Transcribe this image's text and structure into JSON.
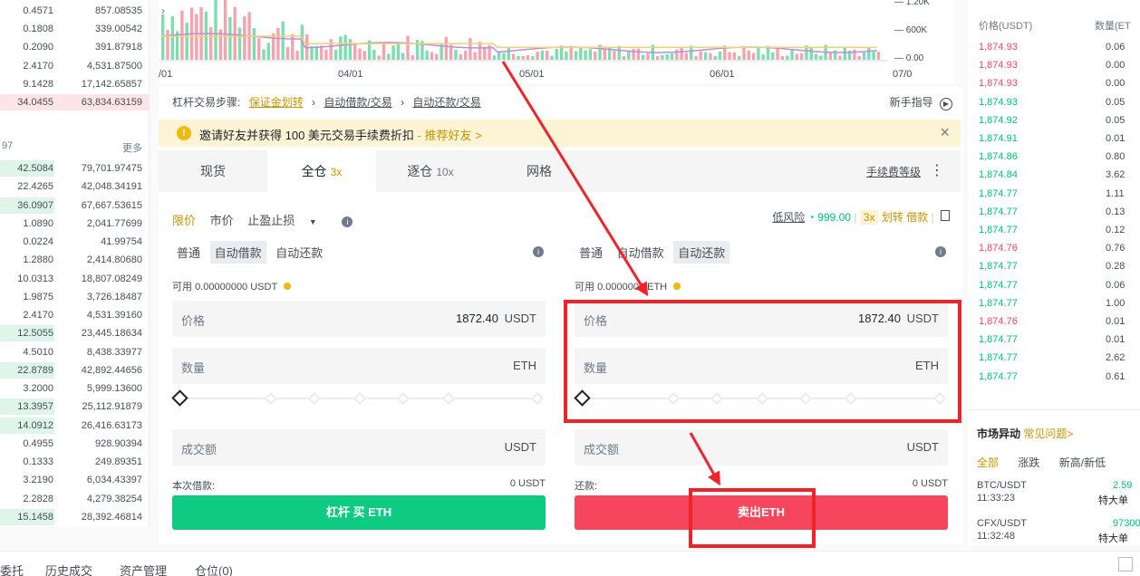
{
  "left_book": {
    "top_rows": [
      {
        "a": "0.4571",
        "b": "857.08535"
      },
      {
        "a": "0.1808",
        "b": "339.00542"
      },
      {
        "a": "0.2090",
        "b": "391.87918"
      },
      {
        "a": "2.4170",
        "b": "4,531.87500"
      },
      {
        "a": "9.1428",
        "b": "17,142.65857"
      },
      {
        "a": "34.0455",
        "b": "63,834.63159"
      }
    ],
    "mid_left": "97",
    "more": "更多",
    "bottom_rows": [
      {
        "a": "42.5084",
        "b": "79,701.97475"
      },
      {
        "a": "22.4265",
        "b": "42,048.34191"
      },
      {
        "a": "36.0907",
        "b": "67,667.53615"
      },
      {
        "a": "1.0890",
        "b": "2,041.77699"
      },
      {
        "a": "0.0224",
        "b": "41.99754"
      },
      {
        "a": "1.2880",
        "b": "2,414.80680"
      },
      {
        "a": "10.0313",
        "b": "18,807.08249"
      },
      {
        "a": "1.9875",
        "b": "3,726.18487"
      },
      {
        "a": "2.4170",
        "b": "4,531.39160"
      },
      {
        "a": "12.5055",
        "b": "23,445.18634"
      },
      {
        "a": "4.5010",
        "b": "8,438.33977"
      },
      {
        "a": "22.8789",
        "b": "42,892.44656"
      },
      {
        "a": "3.2000",
        "b": "5,999.13600"
      },
      {
        "a": "13.3957",
        "b": "25,112.91879"
      },
      {
        "a": "14.0912",
        "b": "26,416.63173"
      },
      {
        "a": "0.4955",
        "b": "928.90394"
      },
      {
        "a": "0.1333",
        "b": "249.89351"
      },
      {
        "a": "3.2190",
        "b": "6,034.43397"
      },
      {
        "a": "2.2828",
        "b": "4,279.38254"
      },
      {
        "a": "15.1458",
        "b": "28,392.46814"
      }
    ]
  },
  "chart": {
    "dates": [
      "/01",
      "04/01",
      "05/01",
      "06/01",
      "07/0"
    ],
    "y_labels": [
      "1.20K",
      "600K",
      "0.00"
    ]
  },
  "steps": {
    "prefix": "杠杆交易步骤:",
    "s1": "保证金划转",
    "s2": "自动借款/交易",
    "s3": "自动还款/交易",
    "guide": "新手指导"
  },
  "notice": {
    "text": "邀请好友并获得 100 美元交易手续费折扣",
    "link": "- 推荐好友 >"
  },
  "tabs": {
    "spot": "现货",
    "cross": "全仓",
    "cross_lev": "3x",
    "isolated": "逐仓",
    "isolated_lev": "10x",
    "grid": "网格",
    "fee_level": "手续费等级"
  },
  "order_type": {
    "limit": "限价",
    "market": "市价",
    "stop": "止盈止损"
  },
  "risk": {
    "label": "低风险",
    "value": "999.00",
    "lev": "3x",
    "transfer": "划转",
    "borrow": "借款"
  },
  "buy": {
    "modes": [
      "普通",
      "自动借款",
      "自动还款"
    ],
    "available_label": "可用",
    "available": "0.00000000 USDT",
    "price_label": "价格",
    "price": "1872.40",
    "price_unit": "USDT",
    "amount_label": "数量",
    "amount_unit": "ETH",
    "total_label": "成交额",
    "total_unit": "USDT",
    "loan_label": "本次借款:",
    "loan_value": "0 USDT",
    "button": "杠杆 买 ETH"
  },
  "sell": {
    "modes": [
      "普通",
      "自动借款",
      "自动还款"
    ],
    "available_label": "可用",
    "available": "0.0000000 ETH",
    "price_label": "价格",
    "price": "1872.40",
    "price_unit": "USDT",
    "amount_label": "数量",
    "amount_unit": "ETH",
    "total_label": "成交额",
    "total_unit": "USDT",
    "repay_label": "还款:",
    "repay_value": "0 USDT",
    "button": "卖出ETH"
  },
  "right_book": {
    "price_header": "价格(USDT)",
    "qty_header": "数量(ET",
    "rows": [
      {
        "p": "1,874.93",
        "q": "0.06",
        "c": "red"
      },
      {
        "p": "1,874.93",
        "q": "0.00",
        "c": "red"
      },
      {
        "p": "1,874.93",
        "q": "0.00",
        "c": "red"
      },
      {
        "p": "1,874.93",
        "q": "0.05",
        "c": "green"
      },
      {
        "p": "1,874.92",
        "q": "0.05",
        "c": "green"
      },
      {
        "p": "1,874.91",
        "q": "0.01",
        "c": "green"
      },
      {
        "p": "1,874.86",
        "q": "0.80",
        "c": "green"
      },
      {
        "p": "1,874.84",
        "q": "3.62",
        "c": "green"
      },
      {
        "p": "1,874.77",
        "q": "1.11",
        "c": "green"
      },
      {
        "p": "1,874.77",
        "q": "0.13",
        "c": "green"
      },
      {
        "p": "1,874.77",
        "q": "0.12",
        "c": "green"
      },
      {
        "p": "1,874.76",
        "q": "0.76",
        "c": "red"
      },
      {
        "p": "1,874.77",
        "q": "0.28",
        "c": "green"
      },
      {
        "p": "1,874.77",
        "q": "0.06",
        "c": "green"
      },
      {
        "p": "1,874.77",
        "q": "1.00",
        "c": "green"
      },
      {
        "p": "1,874.76",
        "q": "0.01",
        "c": "red"
      },
      {
        "p": "1,874.77",
        "q": "0.01",
        "c": "green"
      },
      {
        "p": "1,874.77",
        "q": "2.62",
        "c": "green"
      },
      {
        "p": "1,874.77",
        "q": "0.61",
        "c": "green"
      }
    ]
  },
  "market": {
    "title": "市场异动",
    "faq": "常见问题>",
    "tabs": [
      "全部",
      "涨跌",
      "新高/新低"
    ],
    "items": [
      {
        "pair": "BTC/USDT",
        "value": "2.59",
        "time": "11:33:23",
        "tag": "特大单"
      },
      {
        "pair": "CFX/USDT",
        "value": "97300",
        "time": "11:32:48",
        "tag": "特大单"
      }
    ]
  },
  "bottom_tabs": [
    "委托",
    "历史成交",
    "资产管理",
    "仓位(0)"
  ],
  "colors": {
    "green": "#0ecb81",
    "red": "#f6465d",
    "accent": "#c99400",
    "annotation": "#f0232a"
  }
}
